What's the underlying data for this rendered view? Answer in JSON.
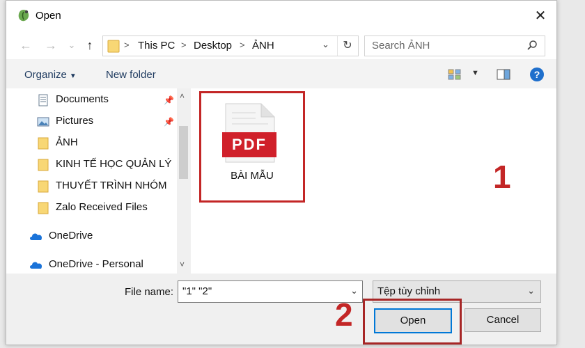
{
  "window": {
    "title": "Open",
    "close_glyph": "✕",
    "icon": "app-leaf-icon"
  },
  "nav": {
    "back_glyph": "←",
    "forward_glyph": "→",
    "recent_glyph": "⌄",
    "up_glyph": "↑",
    "breadcrumbs": [
      "This PC",
      "Desktop",
      "ẢNH"
    ],
    "separator": ">",
    "dropdown_glyph": "⌄",
    "refresh_glyph": "↻",
    "search_placeholder": "Search ẢNH"
  },
  "toolbar": {
    "organize": "Organize",
    "caret": "▼",
    "new_folder": "New folder",
    "help": "?"
  },
  "sidebar": {
    "items": [
      {
        "label": "Documents",
        "icon": "documents-icon",
        "pinned": true
      },
      {
        "label": "Pictures",
        "icon": "pictures-icon",
        "pinned": true
      },
      {
        "label": "ẢNH",
        "icon": "folder-icon"
      },
      {
        "label": "KINH TẾ HỌC QUẢN LÝ",
        "icon": "folder-icon"
      },
      {
        "label": "THUYẾT TRÌNH NHÓM",
        "icon": "folder-icon"
      },
      {
        "label": "Zalo Received Files",
        "icon": "folder-icon"
      }
    ],
    "clouds": [
      {
        "label": "OneDrive",
        "icon": "onedrive-icon"
      },
      {
        "label": "OneDrive - Personal",
        "icon": "onedrive-icon"
      }
    ],
    "pin_glyph": "📌",
    "scroll_up": "˄",
    "scroll_down": "˅"
  },
  "content": {
    "file": {
      "badge": "PDF",
      "name": "BÀI MẪU",
      "icon": "pdf-file-icon"
    },
    "annotation": "1"
  },
  "footer": {
    "filename_label": "File name:",
    "filename_value": "\"1\" \"2\"",
    "dropdown_glyph": "⌄",
    "filetype_value": "Tệp tùy chỉnh",
    "open_label": "Open",
    "cancel_label": "Cancel",
    "annotation": "2"
  },
  "colors": {
    "highlight": "#c32626",
    "accent": "#0078d7",
    "pdf_red": "#d0202a"
  }
}
